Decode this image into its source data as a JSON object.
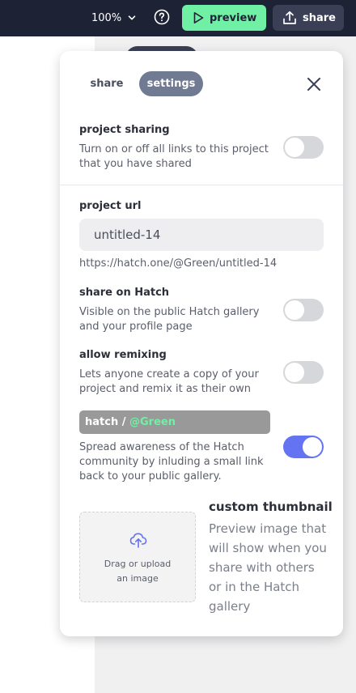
{
  "topbar": {
    "zoom": "100%",
    "preview_label": "preview",
    "share_label": "share"
  },
  "panel": {
    "tabs": {
      "share": "share",
      "settings": "settings"
    },
    "project_sharing": {
      "label": "project sharing",
      "desc1": "Turn on or off all links to this project",
      "desc2": "that you have shared",
      "enabled": false
    },
    "project_url": {
      "label": "project url",
      "value": "untitled-14",
      "full_url": "https://hatch.one/@Green/untitled-14"
    },
    "share_on_hatch": {
      "label": "share on Hatch",
      "desc1": "Visible on the public Hatch gallery",
      "desc2": "and your profile page",
      "enabled": false
    },
    "allow_remixing": {
      "label": "allow remixing",
      "desc1": "Lets anyone create a copy of your",
      "desc2": "project and remix it as their own",
      "enabled": false
    },
    "badge": {
      "prefix": "hatch / ",
      "user": "@Green",
      "desc1": "Spread awareness of the Hatch",
      "desc2": "community by inluding a small link",
      "desc3": "back to your public gallery.",
      "enabled": true
    },
    "thumbnail": {
      "title": "custom thumbnail",
      "upload_line1": "Drag or upload",
      "upload_line2": "an image",
      "desc1": "Preview image that",
      "desc2": "will show when you",
      "desc3": "share with others",
      "desc4": "or in the Hatch",
      "desc5": "gallery"
    }
  },
  "colors": {
    "topbar_bg": "#1e2235",
    "preview_green": "#6ff0a5",
    "toggle_on": "#6373f2",
    "tab_active": "#717a93"
  }
}
